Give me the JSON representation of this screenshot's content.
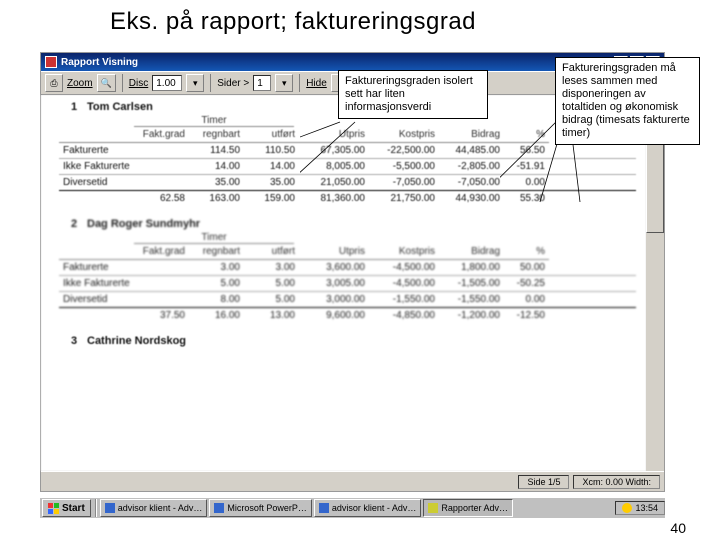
{
  "slide_title": "Eks. på rapport; faktureringsgrad",
  "titlebar": {
    "title": "Rapport Visning"
  },
  "winbuttons": {
    "min": "_",
    "max": "□",
    "close": "×"
  },
  "toolbar": {
    "zoom_label": "Zoom",
    "disc_label": "Disc",
    "disc_value": "1.00",
    "sider_label": "Sider >",
    "sider_value": "1",
    "hide_label": "Hide"
  },
  "columns": [
    "",
    "Fakt.grad",
    "regnbart",
    "utført",
    "Utpris",
    "Kostpris",
    "Bidrag",
    "%"
  ],
  "timer_label": "Timer",
  "emp1": {
    "num": "1",
    "name": "Tom Carlsen"
  },
  "emp1_rows": [
    {
      "label": "Fakturerte",
      "c": [
        "",
        "114.50",
        "110.50",
        "67,305.00",
        "-22,500.00",
        "44,485.00",
        "56.50"
      ]
    },
    {
      "label": "Ikke Fakturerte",
      "c": [
        "",
        "14.00",
        "14.00",
        "8,005.00",
        "-5,500.00",
        "-2,805.00",
        "-51.91"
      ]
    },
    {
      "label": "Diversetid",
      "c": [
        "",
        "35.00",
        "35.00",
        "21,050.00",
        "-7,050.00",
        "-7,050.00",
        "0.00"
      ]
    }
  ],
  "emp1_total": [
    "62.58",
    "163.00",
    "159.00",
    "81,360.00",
    "21,750.00",
    "44,930.00",
    "55.30"
  ],
  "emp2": {
    "num": "2",
    "name": "Dag Roger Sundmyhr"
  },
  "emp2_rows": [
    {
      "label": "Fakturerte",
      "c": [
        "",
        "3.00",
        "3.00",
        "3,600.00",
        "-4,500.00",
        "1,800.00",
        "50.00"
      ]
    },
    {
      "label": "Ikke Fakturerte",
      "c": [
        "",
        "5.00",
        "5.00",
        "3,005.00",
        "-4,500.00",
        "-1,505.00",
        "-50.25"
      ]
    },
    {
      "label": "Diversetid",
      "c": [
        "",
        "8.00",
        "5.00",
        "3,000.00",
        "-1,550.00",
        "-1,550.00",
        "0.00"
      ]
    }
  ],
  "emp2_total": [
    "37.50",
    "16.00",
    "13.00",
    "9,600.00",
    "-4,850.00",
    "-1,200.00",
    "-12.50"
  ],
  "emp3": {
    "num": "3",
    "name": "Cathrine Nordskog"
  },
  "statusbar": {
    "pages": "Side 1/5",
    "coords": "Xcm:  0.00  Width:"
  },
  "taskbar": {
    "start": "Start",
    "tasks": [
      {
        "label": "advisor klient - Adv…"
      },
      {
        "label": "Microsoft PowerP…"
      },
      {
        "label": "advisor klient - Adv…"
      },
      {
        "label": "Rapporter Adv…",
        "active": true
      }
    ],
    "clock": "13:54"
  },
  "callout1": "Faktureringsgraden isolert sett har liten informasjonsverdi",
  "callout2": "Faktureringsgraden må leses sammen med disponeringen av totaltiden og økonomisk bidrag (timesats fakturerte timer)",
  "pagenum": "40"
}
